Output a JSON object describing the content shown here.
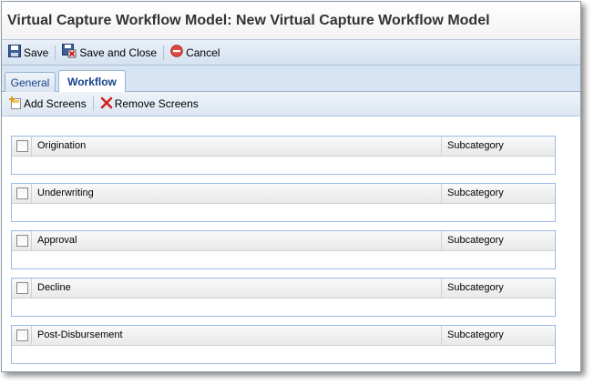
{
  "window": {
    "title": "Virtual Capture Workflow Model: New Virtual Capture Workflow Model"
  },
  "toolbar": {
    "save_label": "Save",
    "save_close_label": "Save and Close",
    "cancel_label": "Cancel"
  },
  "tabs": [
    {
      "label": "General"
    },
    {
      "label": "Workflow"
    }
  ],
  "subtoolbar": {
    "add_label": "Add Screens",
    "remove_label": "Remove Screens"
  },
  "panels": [
    {
      "name": "Origination",
      "subcategory": "Subcategory"
    },
    {
      "name": "Underwriting",
      "subcategory": "Subcategory"
    },
    {
      "name": "Approval",
      "subcategory": "Subcategory"
    },
    {
      "name": "Decline",
      "subcategory": "Subcategory"
    },
    {
      "name": "Post-Disbursement",
      "subcategory": "Subcategory"
    }
  ],
  "colors": {
    "accent": "#15428b",
    "toolbar_bg": "#d5e2f0",
    "panel_border": "#99bbe8"
  }
}
